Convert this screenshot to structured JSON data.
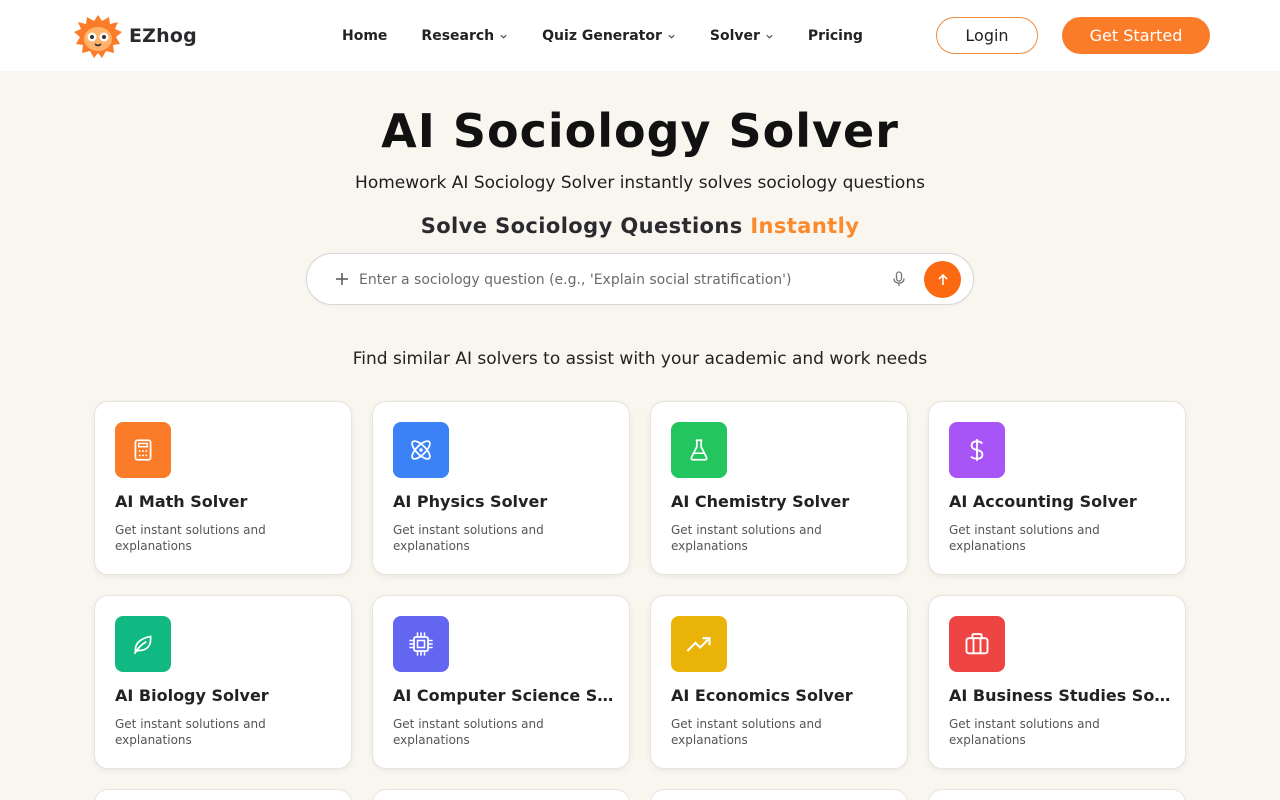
{
  "brand": {
    "name": "EZhog",
    "logo_icon": "hedgehog-logo-icon",
    "brand_color": "#fb7c28"
  },
  "nav": {
    "items": [
      {
        "label": "Home",
        "has_dropdown": false
      },
      {
        "label": "Research",
        "has_dropdown": true
      },
      {
        "label": "Quiz Generator",
        "has_dropdown": true
      },
      {
        "label": "Solver",
        "has_dropdown": true
      },
      {
        "label": "Pricing",
        "has_dropdown": false
      }
    ],
    "login_label": "Login",
    "cta_label": "Get Started"
  },
  "hero": {
    "title": "AI Sociology Solver",
    "subtitle": "Homework AI Sociology Solver instantly solves sociology questions",
    "tagline_main": "Solve Sociology Questions",
    "tagline_accent": "Instantly",
    "accent_color": "#fb8a2c"
  },
  "search": {
    "placeholder": "Enter a sociology question (e.g., 'Explain social stratification')",
    "value": "",
    "plus_icon": "plus-icon",
    "mic_icon": "microphone-icon",
    "send_icon": "arrow-up-icon",
    "send_color": "#fb6a12"
  },
  "solvers": {
    "heading": "Find similar AI solvers to assist with your academic and work needs",
    "cards": [
      {
        "title": "AI Math Solver",
        "desc": "Get instant solutions and explanations",
        "icon": "calculator-icon",
        "color": "#fb7c28"
      },
      {
        "title": "AI Physics Solver",
        "desc": "Get instant solutions and explanations",
        "icon": "atom-icon",
        "color": "#3b82f6"
      },
      {
        "title": "AI Chemistry Solver",
        "desc": "Get instant solutions and explanations",
        "icon": "flask-icon",
        "color": "#22c55e"
      },
      {
        "title": "AI Accounting Solver",
        "desc": "Get instant solutions and explanations",
        "icon": "dollar-icon",
        "color": "#a855f7"
      },
      {
        "title": "AI Biology Solver",
        "desc": "Get instant solutions and explanations",
        "icon": "leaf-icon",
        "color": "#10b981"
      },
      {
        "title": "AI Computer Science Solver",
        "desc": "Get instant solutions and explanations",
        "icon": "cpu-chip-icon",
        "color": "#6366f1"
      },
      {
        "title": "AI Economics Solver",
        "desc": "Get instant solutions and explanations",
        "icon": "trending-up-icon",
        "color": "#eab308"
      },
      {
        "title": "AI Business Studies Solver",
        "desc": "Get instant solutions and explanations",
        "icon": "briefcase-icon",
        "color": "#ef4444"
      }
    ]
  }
}
